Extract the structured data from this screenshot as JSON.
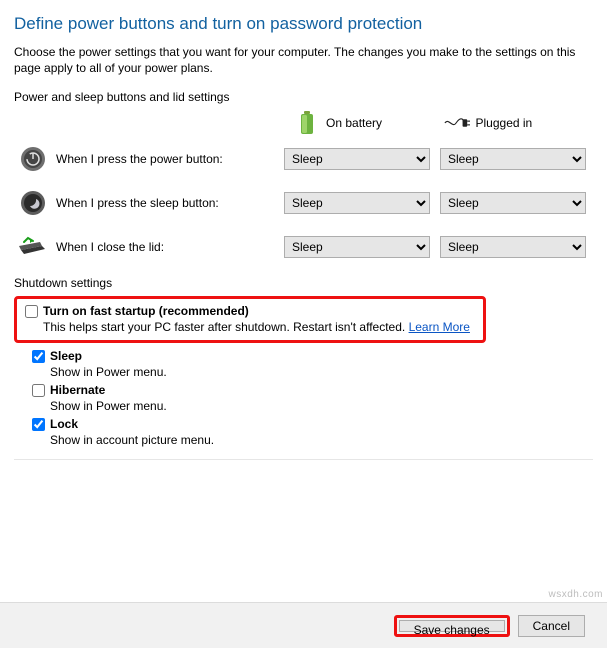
{
  "title": "Define power buttons and turn on password protection",
  "description": "Choose the power settings that you want for your computer. The changes you make to the settings on this page apply to all of your power plans.",
  "section1_label": "Power and sleep buttons and lid settings",
  "headers": {
    "battery": "On battery",
    "plugged": "Plugged in"
  },
  "rows": [
    {
      "id": "power-button",
      "label": "When I press the power button:"
    },
    {
      "id": "sleep-button",
      "label": "When I press the sleep button:"
    },
    {
      "id": "lid",
      "label": "When I close the lid:"
    }
  ],
  "combo_value": "Sleep",
  "shutdown_label": "Shutdown settings",
  "shutdown": [
    {
      "id": "fast-startup",
      "checked": false,
      "label": "Turn on fast startup (recommended)",
      "sub": "This helps start your PC faster after shutdown. Restart isn't affected. ",
      "link": "Learn More",
      "highlight": true
    },
    {
      "id": "sleep",
      "checked": true,
      "label": "Sleep",
      "sub": "Show in Power menu."
    },
    {
      "id": "hibernate",
      "checked": false,
      "label": "Hibernate",
      "sub": "Show in Power menu."
    },
    {
      "id": "lock",
      "checked": true,
      "label": "Lock",
      "sub": "Show in account picture menu."
    }
  ],
  "buttons": {
    "save": "Save changes",
    "cancel": "Cancel"
  },
  "watermark": "wsxdh.com"
}
